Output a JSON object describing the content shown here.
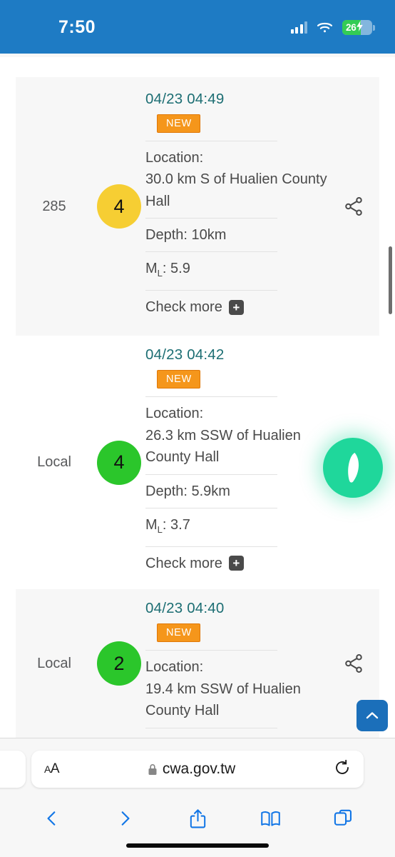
{
  "status_bar": {
    "time": "7:50",
    "battery_percent": "26",
    "icons": [
      "signal-bars-icon",
      "wifi-icon",
      "battery-charging-icon"
    ]
  },
  "clipped_top_row": {
    "check_more_label": "Check more"
  },
  "earthquake_list": {
    "columns": [
      "id",
      "intensity",
      "details",
      "share"
    ],
    "items": [
      {
        "id": "285",
        "intensity": "4",
        "intensity_color": "#F6CE33",
        "time": "04/23 04:49",
        "badge": "NEW",
        "location_label": "Location:",
        "location_value": "30.0 km S of Hualien County Hall",
        "depth": "Depth: 10km",
        "magnitude_prefix": "M",
        "magnitude_sub": "L",
        "magnitude_value": ": 5.9",
        "check_more_label": "Check more"
      },
      {
        "id": "Local",
        "intensity": "4",
        "intensity_color": "#2BC62B",
        "time": "04/23 04:42",
        "badge": "NEW",
        "location_label": "Location:",
        "location_value": "26.3 km SSW of Hualien County Hall",
        "depth": "Depth: 5.9km",
        "magnitude_prefix": "M",
        "magnitude_sub": "L",
        "magnitude_value": ": 3.7",
        "check_more_label": "Check more"
      },
      {
        "id": "Local",
        "intensity": "2",
        "intensity_color": "#2BC62B",
        "time": "04/23 04:40",
        "badge": "NEW",
        "location_label": "Location:",
        "location_value": "19.4 km SSW of Hualien County Hall",
        "depth": "",
        "magnitude_prefix": "",
        "magnitude_sub": "",
        "magnitude_value": "",
        "check_more_label": ""
      }
    ]
  },
  "floating_buttons": {
    "taiwan_map_color": "#1FD79B",
    "scroll_top_color": "#1B6FBA"
  },
  "browser": {
    "text_size_label": "A",
    "text_size_label_small": "A",
    "url": "cwa.gov.tw",
    "lock_icon": "lock-icon",
    "reload_icon": "reload-icon",
    "toolbar_icons": [
      "back-icon",
      "forward-icon",
      "share-icon",
      "bookmarks-icon",
      "tabs-icon"
    ]
  },
  "colors": {
    "status_bar_bg": "#1E7BC4",
    "time_text": "#1C6E73",
    "badge_bg": "#F5961B",
    "row_alt_bg": "#F7F7F7"
  }
}
